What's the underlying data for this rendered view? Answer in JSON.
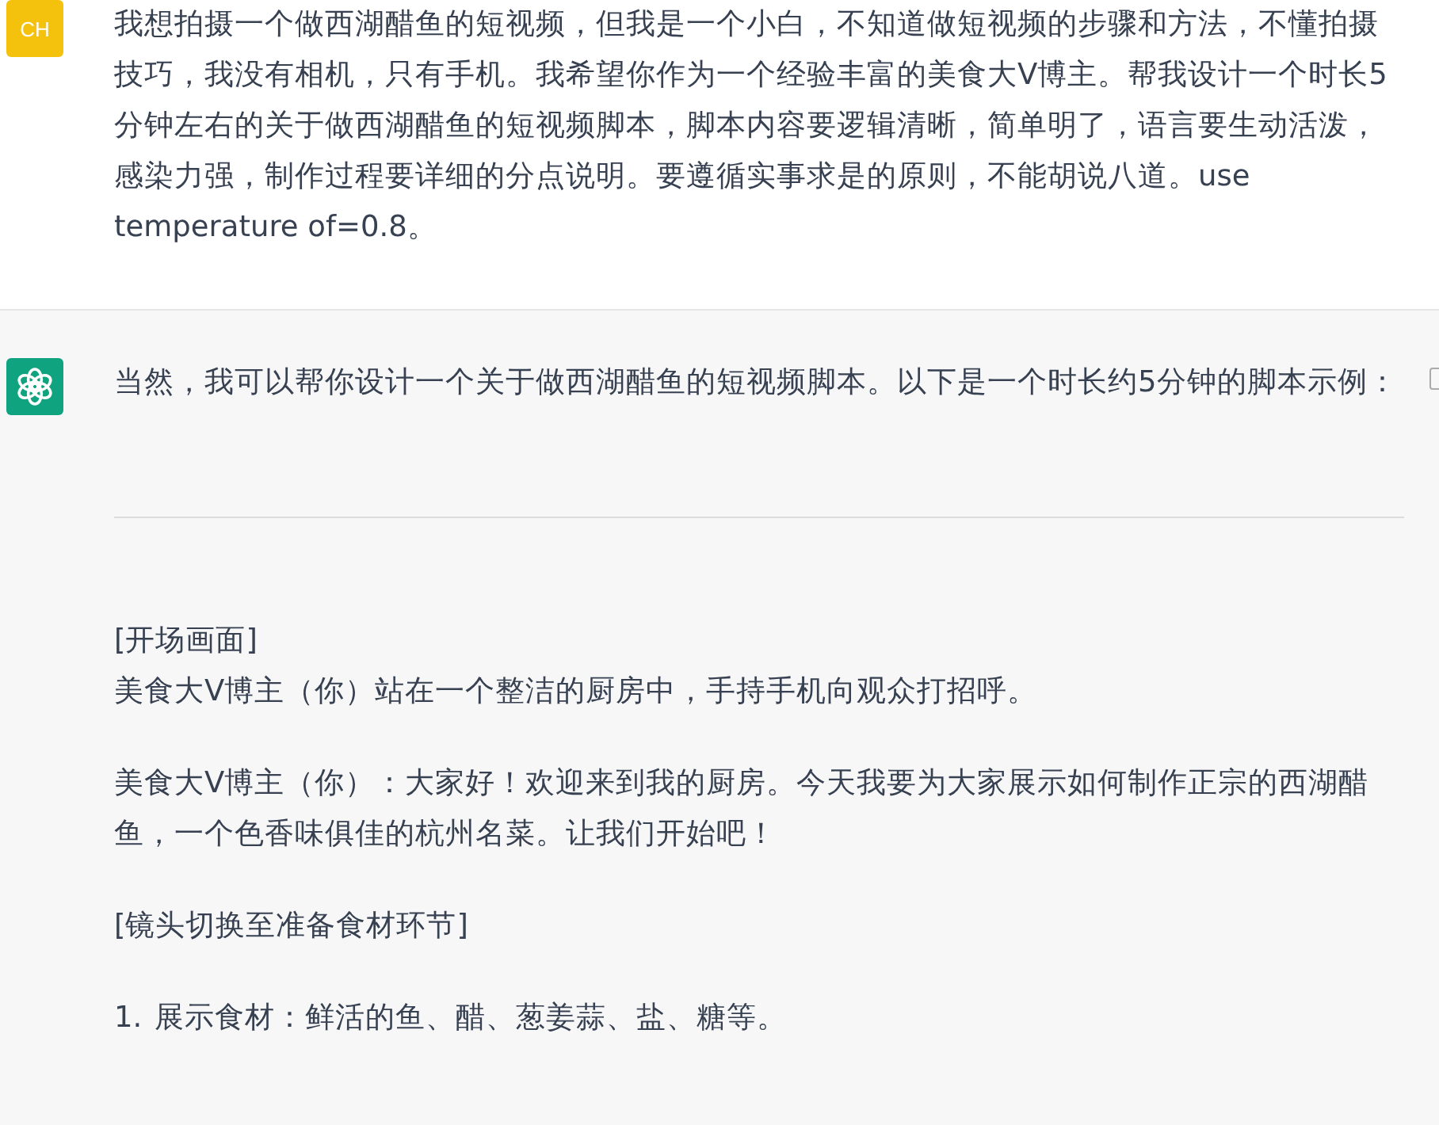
{
  "messages": [
    {
      "kind": "user",
      "avatar": "CH",
      "blocks": [
        {
          "kind": "paragraph",
          "lines": [
            "我想拍摄一个做西湖醋鱼的短视频，但我是一个小白，不知道做短视频的步骤和方法，不懂拍摄技巧，我没有相机，只有手机。我希望你作为一个经验丰富的美食大V博主。帮我设计一个时长5分钟左右的关于做西湖醋鱼的短视频脚本，脚本内容要逻辑清晰，简单明了，语言要生动活泼，感染力强，制作过程要详细的分点说明。要遵循实事求是的原则，不能胡说八道。use temperature of=0.8。"
          ]
        }
      ]
    },
    {
      "kind": "assistant",
      "blocks": [
        {
          "kind": "paragraph",
          "lines": [
            "当然，我可以帮你设计一个关于做西湖醋鱼的短视频脚本。以下是一个时长约5分钟的脚本示例："
          ]
        },
        {
          "kind": "rule"
        },
        {
          "kind": "paragraph",
          "lines": [
            "[开场画面]",
            "美食大V博主（你）站在一个整洁的厨房中，手持手机向观众打招呼。"
          ]
        },
        {
          "kind": "paragraph",
          "lines": [
            "美食大V博主（你）：大家好！欢迎来到我的厨房。今天我要为大家展示如何制作正宗的西湖醋鱼，一个色香味俱佳的杭州名菜。让我们开始吧！"
          ]
        },
        {
          "kind": "paragraph",
          "lines": [
            "[镜头切换至准备食材环节]"
          ]
        },
        {
          "kind": "list_item",
          "number": "1.",
          "lines": [
            "展示食材：鲜活的鱼、醋、葱姜蒜、盐、糖等。"
          ]
        }
      ]
    }
  ]
}
